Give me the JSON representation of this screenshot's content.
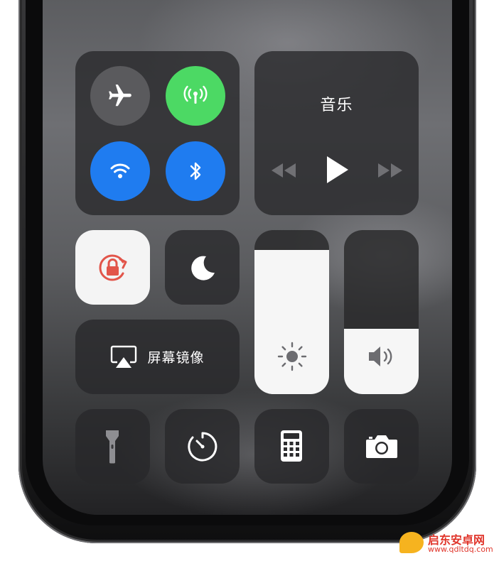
{
  "connectivity": {
    "airplane_icon": "airplane-icon",
    "cellular_icon": "cellular-antenna-icon",
    "wifi_icon": "wifi-icon",
    "bluetooth_icon": "bluetooth-icon",
    "colors": {
      "gray": "#5a5a5d",
      "green": "#4cd964",
      "blue": "#1f7cf0"
    }
  },
  "music": {
    "title": "音乐",
    "controls": [
      "rewind-icon",
      "play-icon",
      "fast-forward-icon"
    ]
  },
  "toggles": {
    "rotation_lock_icon": "rotation-lock-icon",
    "do_not_disturb_icon": "moon-icon",
    "rotation_lock_color": "#e2554a"
  },
  "screen_mirroring": {
    "label": "屏幕镜像",
    "icon": "airplay-icon"
  },
  "sliders": {
    "brightness": {
      "level": 0.88,
      "icon": "sun-icon"
    },
    "volume": {
      "level": 0.4,
      "icon": "speaker-icon"
    }
  },
  "shortcuts": [
    "flashlight-icon",
    "timer-icon",
    "calculator-icon",
    "camera-icon"
  ],
  "watermark": {
    "name": "启东安卓网",
    "url": "www.qdltdq.com"
  }
}
